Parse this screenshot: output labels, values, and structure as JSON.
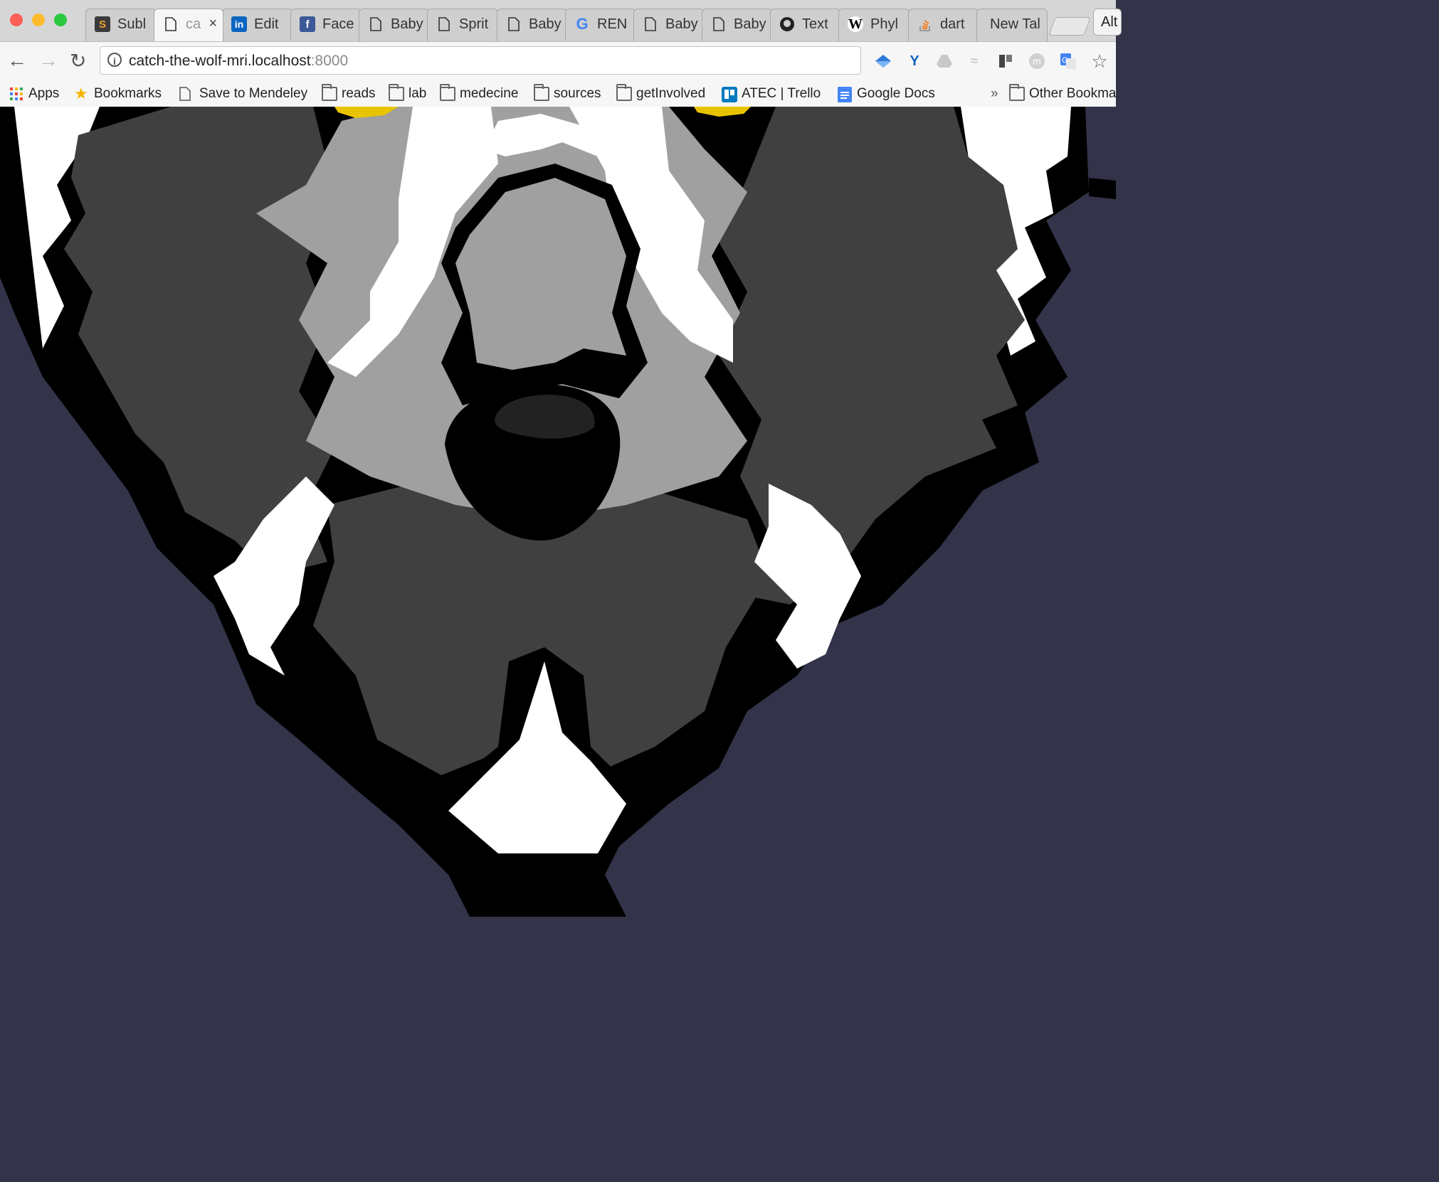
{
  "window": {
    "tabs": [
      {
        "label": "Subl",
        "icon": "sublime-text-icon"
      },
      {
        "label": "ca",
        "icon": "page-icon",
        "active": true
      },
      {
        "label": "Edit",
        "icon": "linkedin-icon"
      },
      {
        "label": "Face",
        "icon": "facebook-icon"
      },
      {
        "label": "Baby",
        "icon": "page-icon"
      },
      {
        "label": "Sprit",
        "icon": "page-icon"
      },
      {
        "label": "Baby",
        "icon": "page-icon"
      },
      {
        "label": "REN",
        "icon": "google-icon"
      },
      {
        "label": "Baby",
        "icon": "page-icon"
      },
      {
        "label": "Baby",
        "icon": "page-icon"
      },
      {
        "label": "Text",
        "icon": "github-icon"
      },
      {
        "label": "Phyl",
        "icon": "wikipedia-icon"
      },
      {
        "label": "dart",
        "icon": "stackoverflow-icon"
      },
      {
        "label": "New Tal",
        "icon": ""
      }
    ],
    "profile_label": "Alt"
  },
  "toolbar": {
    "url_host": "catch-the-wolf-mri.localhost",
    "url_port": ":8000"
  },
  "bookmarks": {
    "items": [
      {
        "label": "Apps",
        "icon": "apps-grid-icon"
      },
      {
        "label": "Bookmarks",
        "icon": "star-icon"
      },
      {
        "label": "Save to Mendeley",
        "icon": "page-icon"
      },
      {
        "label": "reads",
        "icon": "folder-icon"
      },
      {
        "label": "lab",
        "icon": "folder-icon"
      },
      {
        "label": "medecine",
        "icon": "folder-icon"
      },
      {
        "label": "sources",
        "icon": "folder-icon"
      },
      {
        "label": "getInvolved",
        "icon": "folder-icon"
      },
      {
        "label": "ATEC | Trello",
        "icon": "trello-icon"
      },
      {
        "label": "Google Docs",
        "icon": "google-docs-icon"
      }
    ],
    "overflow": "»",
    "other_label": "Other Bookma"
  },
  "colors": {
    "page_background": "#33344a",
    "fur_dark": "#404040",
    "fur_mid": "#a0a0a0",
    "fur_white": "#ffffff",
    "outline": "#000000",
    "eye": "#e8c400"
  }
}
